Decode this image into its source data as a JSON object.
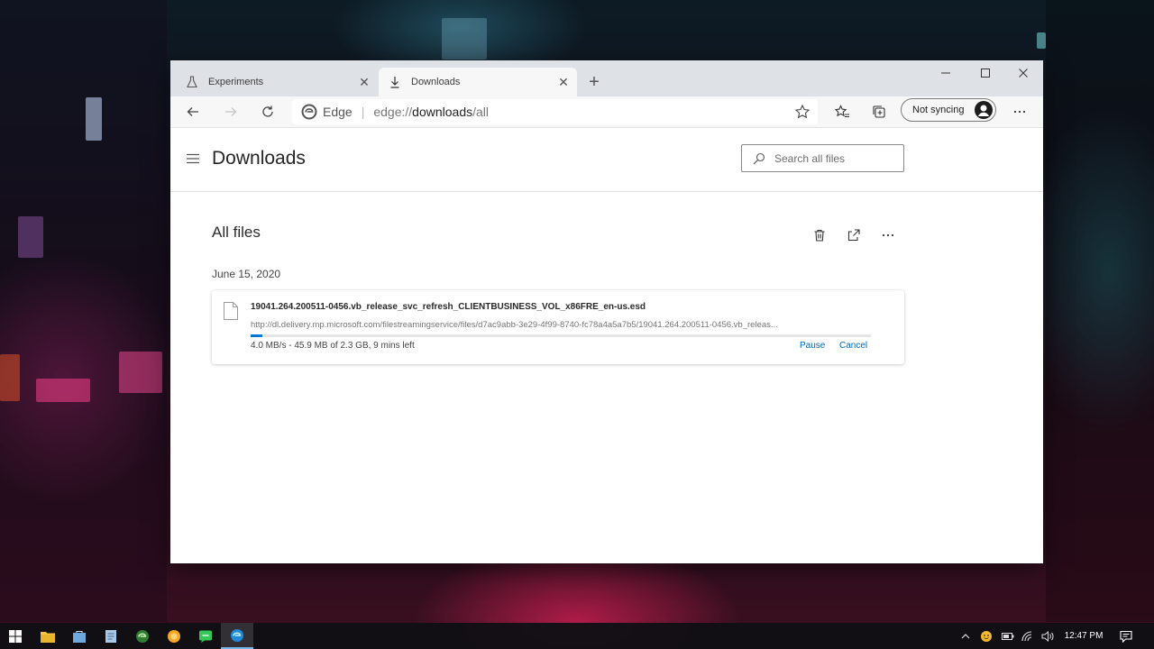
{
  "browser": {
    "tabs": [
      {
        "label": "Experiments",
        "icon": "flask-icon",
        "active": false
      },
      {
        "label": "Downloads",
        "icon": "download-arrow-icon",
        "active": true
      }
    ],
    "address": {
      "site_name": "Edge",
      "url_scheme": "edge://",
      "url_host": "downloads",
      "url_path": "/all"
    },
    "sync_label": "Not syncing"
  },
  "page": {
    "title": "Downloads",
    "search_placeholder": "Search all files",
    "section_title": "All files",
    "date_group": "June 15, 2020",
    "downloads": [
      {
        "filename": "19041.264.200511-0456.vb_release_svc_refresh_CLIENTBUSINESS_VOL_x86FRE_en-us.esd",
        "url": "http://dl.delivery.mp.microsoft.com/filestreamingservice/files/d7ac9abb-3e29-4f99-8740-fc78a4a5a7b5/19041.264.200511-0456.vb_releas...",
        "status": "4.0 MB/s - 45.9 MB of 2.3 GB, 9 mins left",
        "progress_fraction": 0.0195,
        "pause_label": "Pause",
        "cancel_label": "Cancel"
      }
    ]
  },
  "taskbar": {
    "clock": "12:47 PM"
  },
  "colors": {
    "accent": "#0078d4",
    "link": "#0067b8",
    "titlebar": "#dee1e6",
    "toolbar": "#f7f7f7"
  }
}
